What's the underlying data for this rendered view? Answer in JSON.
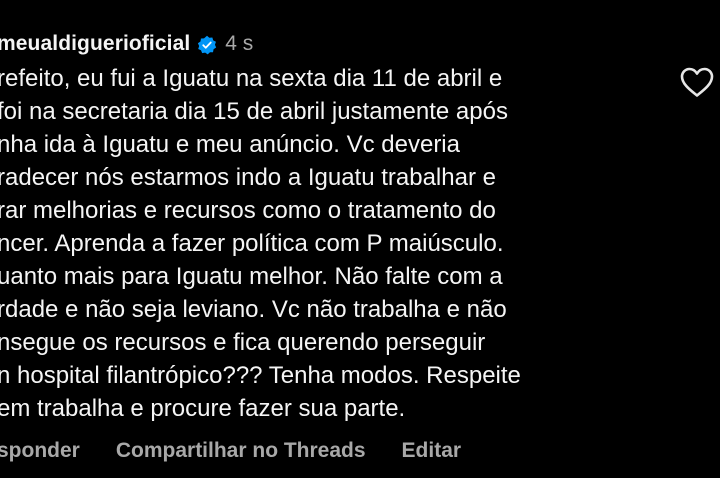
{
  "comment": {
    "username": "meualdiguerioficial",
    "verified_icon": "verified-badge-icon",
    "timestamp": "4 s",
    "lines": [
      "refeito, eu fui  a Iguatu na sexta dia 11 de abril e",
      "foi na secretaria dia 15 de abril justamente após",
      "nha ida à Iguatu e meu anúncio. Vc deveria",
      "radecer nós estarmos indo a Iguatu trabalhar e",
      "rar melhorias e recursos  como o tratamento do",
      "ncer. Aprenda a fazer política com P maiúsculo.",
      "uanto mais para Iguatu melhor. Não falte com a",
      "rdade e não seja leviano. Vc não trabalha e não",
      "nsegue os recursos e fica querendo perseguir",
      "n hospital filantrópico??? Tenha modos. Respeite",
      "em trabalha e procure fazer sua parte."
    ],
    "actions": {
      "reply": "sponder",
      "share_threads": "Compartilhar no Threads",
      "edit": "Editar"
    },
    "like_icon": "heart-outline-icon"
  },
  "colors": {
    "background": "#000000",
    "text": "#f5f5f5",
    "muted": "#a8a8a8",
    "verified": "#0095f6"
  }
}
